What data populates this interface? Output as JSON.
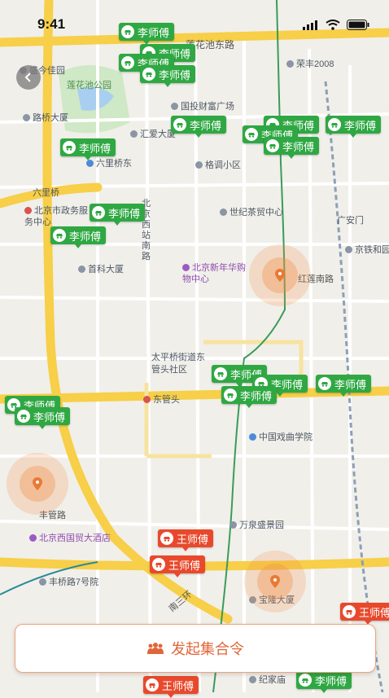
{
  "status_bar": {
    "time": "9:41"
  },
  "map": {
    "road_labels": [
      "莲花池东路",
      "六里桥",
      "南三环",
      "丰管路",
      "东管头"
    ],
    "pois": [
      {
        "name": "盛今佳园",
        "style": "gray"
      },
      {
        "name": "莲花池公园",
        "style": "park"
      },
      {
        "name": "荣丰2008",
        "style": "gray"
      },
      {
        "name": "路桥大厦",
        "style": "gray"
      },
      {
        "name": "国投财富广场",
        "style": "gray"
      },
      {
        "name": "汇爱大厦",
        "style": "gray"
      },
      {
        "name": "六里桥东",
        "style": "blue"
      },
      {
        "name": "格调小区",
        "style": "gray"
      },
      {
        "name": "北京市政务服务中心",
        "style": "red"
      },
      {
        "name": "世纪茶贸中心",
        "style": "gray"
      },
      {
        "name": "广安门",
        "style": "plain"
      },
      {
        "name": "京铁和园",
        "style": "gray"
      },
      {
        "name": "首科大厦",
        "style": "gray"
      },
      {
        "name": "北京新年华购物中心",
        "style": "purple"
      },
      {
        "name": "红莲南路",
        "style": "plain"
      },
      {
        "name": "太平桥街道东管头社区",
        "style": "plain"
      },
      {
        "name": "东管头",
        "style": "plain"
      },
      {
        "name": "中国戏曲学院",
        "style": "blue"
      },
      {
        "name": "万泉盛景园",
        "style": "gray"
      },
      {
        "name": "北京西国贸大酒店",
        "style": "purple"
      },
      {
        "name": "丰桥路7号院",
        "style": "gray"
      },
      {
        "name": "宝隆大厦",
        "style": "gray"
      },
      {
        "name": "纪家庙",
        "style": "gray"
      },
      {
        "name": "北京西站南路",
        "style": "plain"
      }
    ],
    "driver_tags": [
      {
        "name": "李师傅",
        "color": "green"
      },
      {
        "name": "李师傅",
        "color": "green"
      },
      {
        "name": "李师傅",
        "color": "green"
      },
      {
        "name": "李师傅",
        "color": "green"
      },
      {
        "name": "李师傅",
        "color": "green"
      },
      {
        "name": "李师傅",
        "color": "green"
      },
      {
        "name": "李师傅",
        "color": "green"
      },
      {
        "name": "李师傅",
        "color": "green"
      },
      {
        "name": "李师傅",
        "color": "green"
      },
      {
        "name": "李师傅",
        "color": "green"
      },
      {
        "name": "李师傅",
        "color": "green"
      },
      {
        "name": "李师傅",
        "color": "green"
      },
      {
        "name": "李师傅",
        "color": "green"
      },
      {
        "name": "李师傅",
        "color": "green"
      },
      {
        "name": "李师傅",
        "color": "green"
      },
      {
        "name": "李师傅",
        "color": "green"
      },
      {
        "name": "李师傅",
        "color": "green"
      },
      {
        "name": "李师傅",
        "color": "green"
      },
      {
        "name": "王师傅",
        "color": "red"
      },
      {
        "name": "王师傅",
        "color": "red"
      },
      {
        "name": "王师傅",
        "color": "red"
      },
      {
        "name": "王师傅",
        "color": "red"
      },
      {
        "name": "李师傅",
        "color": "green"
      }
    ]
  },
  "cta": {
    "label": "发起集合令",
    "icon": "group-icon"
  },
  "colors": {
    "accent": "#e0663a",
    "driver_green": "#2fa843",
    "driver_red": "#e8492c"
  }
}
